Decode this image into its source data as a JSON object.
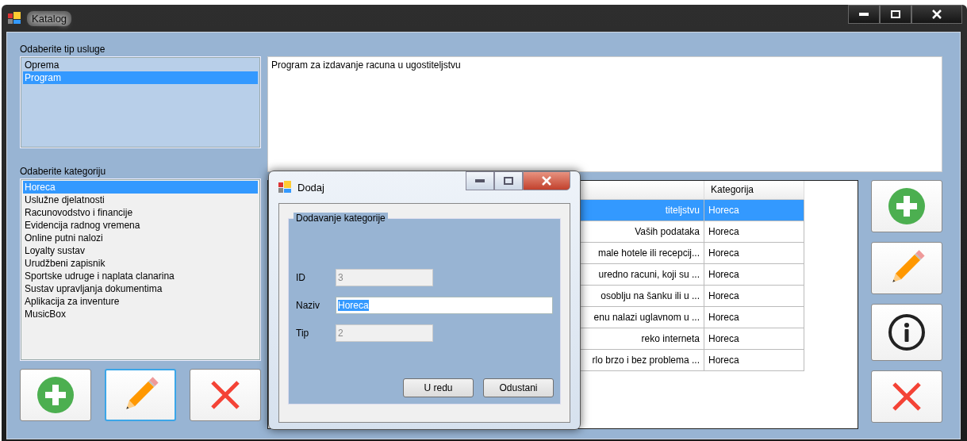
{
  "window": {
    "title": "Katalog"
  },
  "service_types": {
    "label": "Odaberite tip usluge",
    "items": [
      {
        "label": "Oprema",
        "selected": false
      },
      {
        "label": "Program",
        "selected": true
      }
    ]
  },
  "description": {
    "value": "Program za izdavanje racuna u ugostiteljstvu"
  },
  "categories": {
    "label": "Odaberite kategoriju",
    "items": [
      {
        "label": "Horeca",
        "selected": true
      },
      {
        "label": "Uslužne djelatnosti",
        "selected": false
      },
      {
        "label": "Racunovodstvo i financije",
        "selected": false
      },
      {
        "label": "Evidencija radnog vremena",
        "selected": false
      },
      {
        "label": "Online putni nalozi",
        "selected": false
      },
      {
        "label": "Loyalty sustav",
        "selected": false
      },
      {
        "label": "Urudžbeni zapisnik",
        "selected": false
      },
      {
        "label": "Sportske udruge i naplata clanarina",
        "selected": false
      },
      {
        "label": "Sustav upravljanja dokumentima",
        "selected": false
      },
      {
        "label": "Aplikacija za inventure",
        "selected": false
      },
      {
        "label": "MusicBox",
        "selected": false
      }
    ]
  },
  "category_buttons": [
    {
      "kind": "add",
      "focused": false
    },
    {
      "kind": "edit",
      "focused": true
    },
    {
      "kind": "delete",
      "focused": false
    }
  ],
  "table": {
    "columns": [
      "Kategorija"
    ],
    "rows": [
      {
        "column_1": "titeljstvu",
        "kategorija": "Horeca",
        "selected": true
      },
      {
        "column_1": "Vaših podataka",
        "kategorija": "Horeca",
        "selected": false
      },
      {
        "column_1": "male hotele ili recepcij...",
        "kategorija": "Horeca",
        "selected": false
      },
      {
        "column_1": "uredno racuni, koji su ...",
        "kategorija": "Horeca",
        "selected": false
      },
      {
        "column_1": "osoblju na šanku ili u ...",
        "kategorija": "Horeca",
        "selected": false
      },
      {
        "column_1": "enu nalazi uglavnom u ...",
        "kategorija": "Horeca",
        "selected": false
      },
      {
        "column_1": "reko interneta",
        "kategorija": "Horeca",
        "selected": false
      },
      {
        "column_1": "rlo brzo i bez problema ...",
        "kategorija": "Horeca",
        "selected": false
      }
    ]
  },
  "product_buttons": [
    {
      "kind": "add"
    },
    {
      "kind": "edit"
    },
    {
      "kind": "info"
    },
    {
      "kind": "delete"
    }
  ],
  "dialog": {
    "title": "Dodaj",
    "group_title": "Dodavanje kategorije",
    "fields": [
      {
        "label": "ID",
        "value": "3",
        "disabled": true,
        "text_selected": false,
        "wide": false
      },
      {
        "label": "Naziv",
        "value": "Horeca",
        "disabled": false,
        "text_selected": true,
        "wide": true
      },
      {
        "label": "Tip",
        "value": "2",
        "disabled": true,
        "text_selected": false,
        "wide": false
      }
    ],
    "buttons": [
      "U redu",
      "Odustani"
    ]
  }
}
